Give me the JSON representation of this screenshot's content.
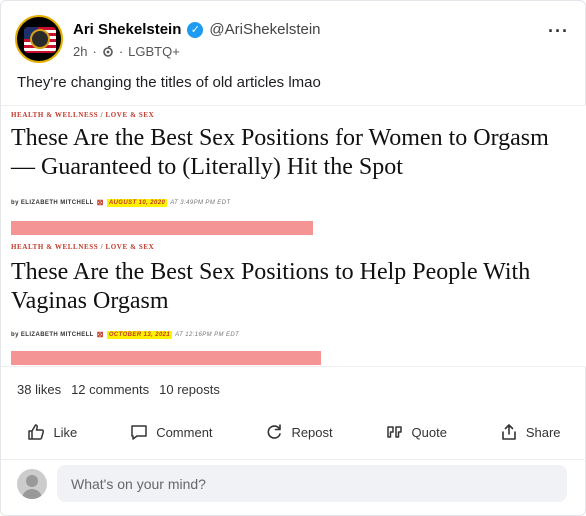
{
  "author": {
    "name": "Ari Shekelstein",
    "handle": "@AriShekelstein",
    "time": "2h",
    "separator": "·",
    "community": "LGBTQ+"
  },
  "post": {
    "text": "They're changing the titles of old articles lmao"
  },
  "articles": [
    {
      "category": "HEALTH & WELLNESS / LOVE & SEX",
      "title_line1": "These Are the Best Sex Positions for Women to Orgasm",
      "title_line2": "— Guaranteed to (Literally) Hit the Spot",
      "byline": "by ELIZABETH MITCHELL",
      "date": "AUGUST 10, 2020",
      "time": "AT 3:49PM PM EDT"
    },
    {
      "category": "HEALTH & WELLNESS / LOVE & SEX",
      "title_line1": "These Are the Best Sex Positions to Help People With",
      "title_line2": "Vaginas Orgasm",
      "byline": "by ELIZABETH MITCHELL",
      "date": "OCTOBER 13, 2021",
      "time": "AT 12:16PM PM EDT"
    }
  ],
  "stats": {
    "likes": "38 likes",
    "comments": "12 comments",
    "reposts": "10 reposts"
  },
  "actions": {
    "like": "Like",
    "comment": "Comment",
    "repost": "Repost",
    "quote": "Quote",
    "share": "Share"
  },
  "composer": {
    "placeholder": "What's on your mind?"
  },
  "colors": {
    "verified": "#1d9bf0",
    "highlight": "#fff200",
    "accent_red": "#c0392b",
    "pink_bar": "#f59494"
  },
  "icons": [
    "more-icon",
    "verified-icon",
    "threads-icon",
    "like-icon",
    "comment-icon",
    "repost-icon",
    "quote-icon",
    "share-icon",
    "avatar-placeholder-icon"
  ]
}
